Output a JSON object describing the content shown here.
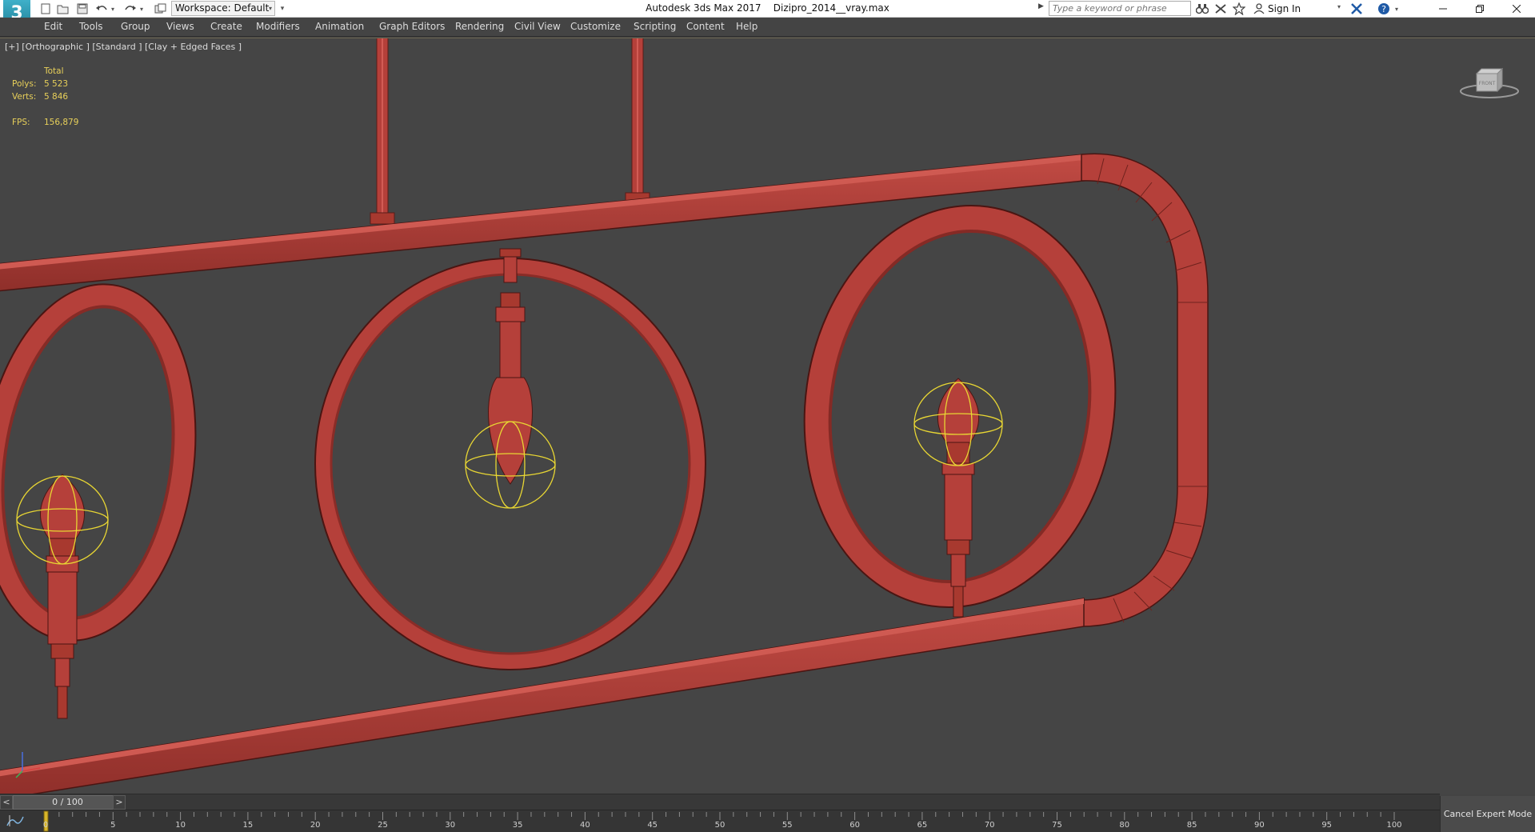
{
  "title_bar": {
    "app_logo": "3",
    "workspace": "Workspace: Default",
    "window_title": "Autodesk 3ds Max 2017",
    "file_name": "Dizipro_2014__vray.max",
    "search_placeholder": "Type a keyword or phrase",
    "sign_in": "Sign In"
  },
  "menu": {
    "items": [
      "Edit",
      "Tools",
      "Group",
      "Views",
      "Create",
      "Modifiers",
      "Animation",
      "Graph Editors",
      "Rendering",
      "Civil View",
      "Customize",
      "Scripting",
      "Content",
      "Help"
    ]
  },
  "viewport": {
    "label": "[+] [Orthographic ] [Standard ] [Clay + Edged Faces ]",
    "stats": {
      "total_label": "Total",
      "polys_label": "Polys:",
      "polys_value": "5 523",
      "verts_label": "Verts:",
      "verts_value": "5 846",
      "fps_label": "FPS:",
      "fps_value": "156,879"
    },
    "viewcube_label": "FRONT",
    "model_color": "#b5403a",
    "selection_color": "#e8d633"
  },
  "timeline": {
    "prev": "<",
    "next": ">",
    "frame_display": "0 / 100",
    "current_frame": 0,
    "frame_count": 100,
    "tick_labels": [
      "0",
      "5",
      "10",
      "15",
      "20",
      "25",
      "30",
      "35",
      "40",
      "45",
      "50",
      "55",
      "60",
      "65",
      "70",
      "75",
      "80",
      "85",
      "90",
      "95",
      "100"
    ]
  },
  "status": {
    "cancel_expert_mode": "Cancel Expert Mode"
  }
}
